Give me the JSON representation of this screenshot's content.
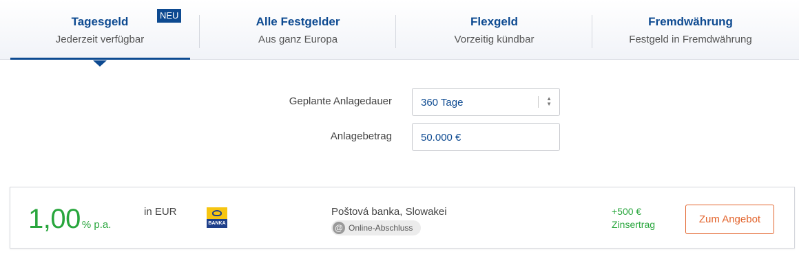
{
  "tabs": [
    {
      "title": "Tagesgeld",
      "subtitle": "Jederzeit verfügbar",
      "badge": "NEU",
      "active": true
    },
    {
      "title": "Alle Festgelder",
      "subtitle": "Aus ganz Europa"
    },
    {
      "title": "Flexgeld",
      "subtitle": "Vorzeitig kündbar"
    },
    {
      "title": "Fremdwährung",
      "subtitle": "Festgeld in Fremdwährung"
    }
  ],
  "form": {
    "duration_label": "Geplante Anlagedauer",
    "duration_value": "360 Tage",
    "amount_label": "Anlagebetrag",
    "amount_value": "50.000 €"
  },
  "offer": {
    "rate": "1,00",
    "rate_unit": "% p.a.",
    "currency": "in EUR",
    "bank_logo_text": "BANKA",
    "bank_name": "Poštová banka, Slowakei",
    "online_label": "Online-Abschluss",
    "online_icon": "@",
    "interest_amount": "+500 €",
    "interest_label": "Zinsertrag",
    "cta_label": "Zum Angebot"
  },
  "colors": {
    "brand": "#0d4a91",
    "rate_green": "#29a63d",
    "cta_orange": "#e2622a"
  }
}
